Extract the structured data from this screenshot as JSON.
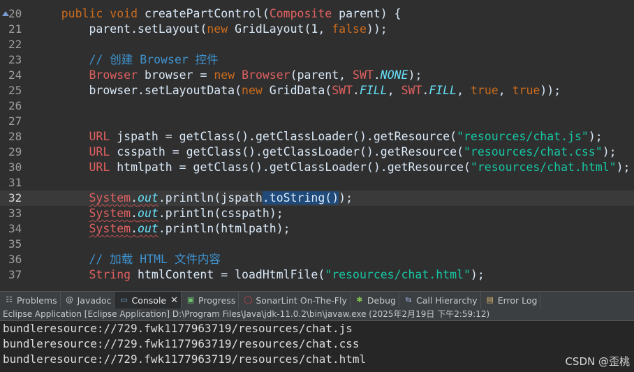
{
  "editor": {
    "lines": [
      {
        "num": "20",
        "code": "    public void createPartControl(Composite parent) {"
      },
      {
        "num": "21",
        "code": "        parent.setLayout(new GridLayout(1, false));"
      },
      {
        "num": "22",
        "code": ""
      },
      {
        "num": "23",
        "code": "        // 创建 Browser 控件"
      },
      {
        "num": "24",
        "code": "        Browser browser = new Browser(parent, SWT.NONE);"
      },
      {
        "num": "25",
        "code": "        browser.setLayoutData(new GridData(SWT.FILL, SWT.FILL, true, true));"
      },
      {
        "num": "26",
        "code": ""
      },
      {
        "num": "27",
        "code": ""
      },
      {
        "num": "28",
        "code": "        URL jspath = getClass().getClassLoader().getResource(\"resources/chat.js\");"
      },
      {
        "num": "29",
        "code": "        URL csspath = getClass().getClassLoader().getResource(\"resources/chat.css\");"
      },
      {
        "num": "30",
        "code": "        URL htmlpath = getClass().getClassLoader().getResource(\"resources/chat.html\");"
      },
      {
        "num": "31",
        "code": ""
      },
      {
        "num": "32",
        "code": "        System.out.println(jspath.toString());"
      },
      {
        "num": "33",
        "code": "        System.out.println(csspath);"
      },
      {
        "num": "34",
        "code": "        System.out.println(htmlpath);"
      },
      {
        "num": "35",
        "code": ""
      },
      {
        "num": "36",
        "code": "        // 加载 HTML 文件内容"
      },
      {
        "num": "37",
        "code": "        String htmlContent = loadHtmlFile(\"resources/chat.html\");"
      }
    ]
  },
  "tabs": [
    {
      "label": "Problems",
      "icon": "problems-icon"
    },
    {
      "label": "Javadoc",
      "icon": "javadoc-icon"
    },
    {
      "label": "Console",
      "icon": "console-icon"
    },
    {
      "label": "Progress",
      "icon": "progress-icon"
    },
    {
      "label": "SonarLint On-The-Fly",
      "icon": "sonarlint-icon"
    },
    {
      "label": "Debug",
      "icon": "debug-icon"
    },
    {
      "label": "Call Hierarchy",
      "icon": "call-hierarchy-icon"
    },
    {
      "label": "Error Log",
      "icon": "error-log-icon"
    }
  ],
  "console": {
    "header": "Eclipse Application [Eclipse Application] D:\\Program Files\\Java\\jdk-11.0.2\\bin\\javaw.exe  (2025年2月19日 下午2:59:12)",
    "lines": [
      "bundleresource://729.fwk1177963719/resources/chat.js",
      "bundleresource://729.fwk1177963719/resources/chat.css",
      "bundleresource://729.fwk1177963719/resources/chat.html"
    ]
  },
  "watermark": "CSDN @歪桃"
}
